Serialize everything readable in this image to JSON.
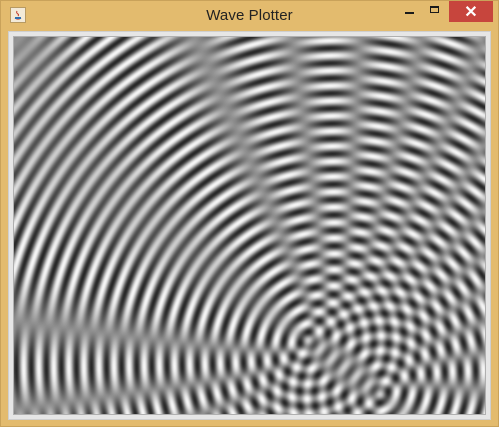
{
  "window": {
    "title": "Wave Plotter",
    "accent_color": "#e3bb6e",
    "close_color": "#c7453d"
  },
  "titlebar": {
    "icon": "java-app-icon",
    "minimize_icon": "minimize-icon",
    "maximize_icon": "maximize-icon",
    "close_icon": "close-icon",
    "close_label": "✕"
  },
  "plot": {
    "description_icon": "wave-interference-canvas",
    "colors": {
      "dark": "#1a1a1a",
      "mid": "#8f8f8f",
      "light": "#f0f0f0"
    }
  }
}
